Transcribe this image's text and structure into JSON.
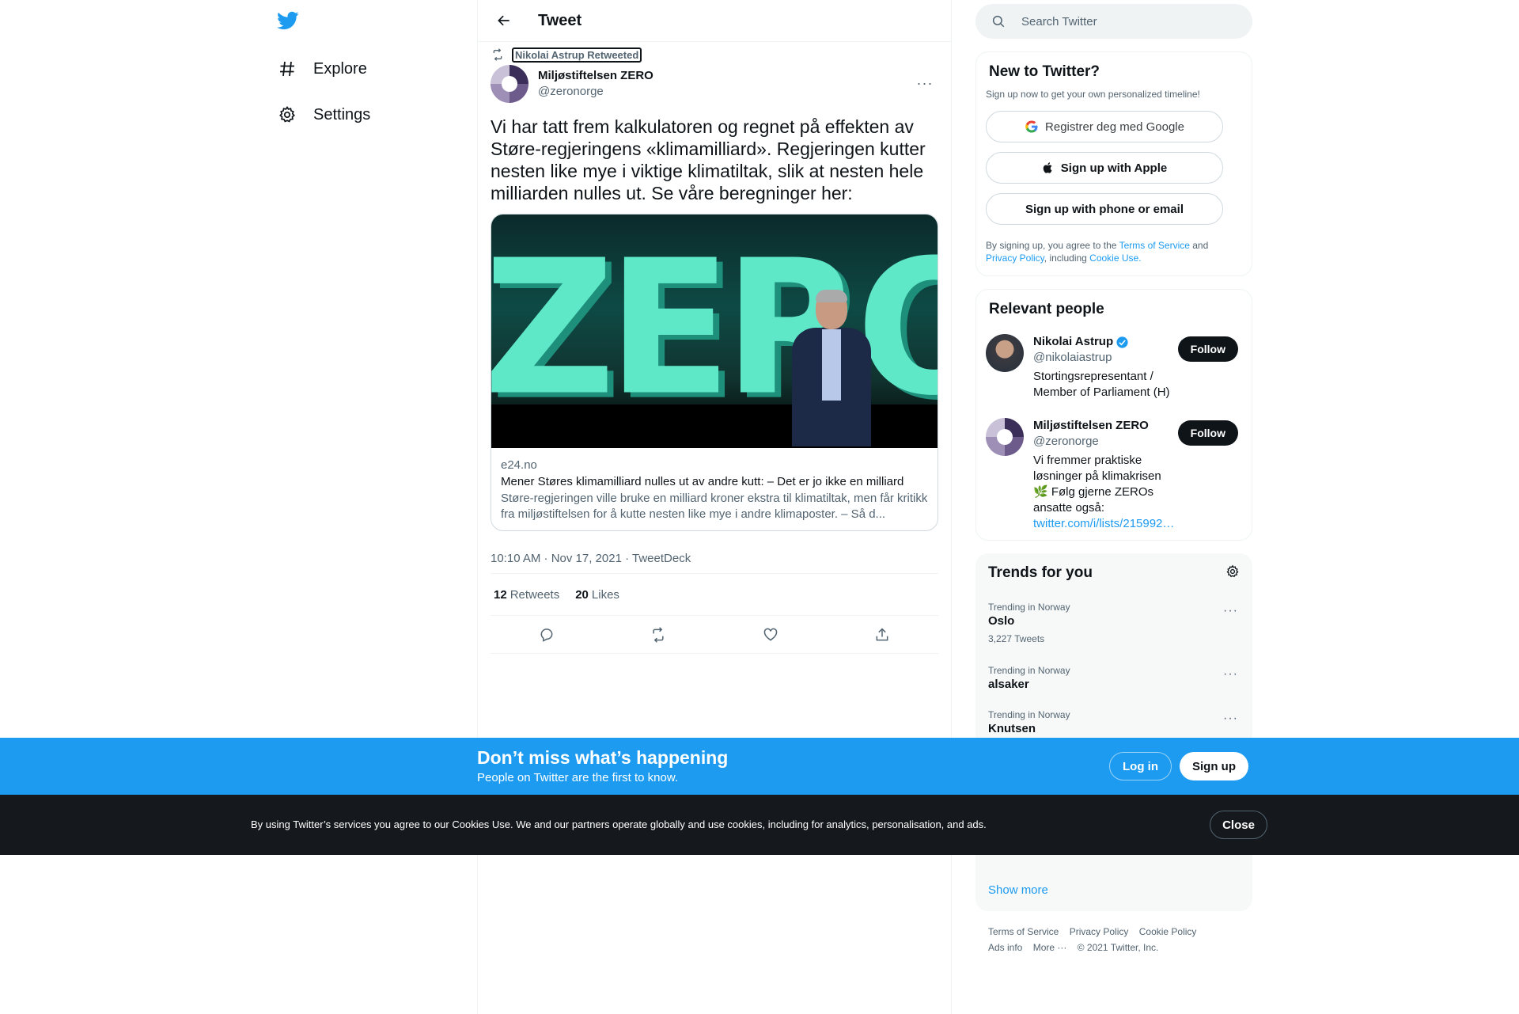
{
  "nav": {
    "logo": "twitter-bird-icon",
    "items": [
      {
        "label": "Explore",
        "icon": "hashtag-icon"
      },
      {
        "label": "Settings",
        "icon": "gear-icon"
      }
    ]
  },
  "header": {
    "title": "Tweet"
  },
  "tweet": {
    "retweeted_by": "Nikolai Astrup Retweeted",
    "author_name": "Miljøstiftelsen ZERO",
    "author_handle": "@zeronorge",
    "text": "Vi har tatt frem kalkulatoren og regnet på effekten av Støre-regjeringens «klimamilliard». Regjeringen kutter nesten like mye i viktige klimatiltak, slik at nesten hele milliarden nulles ut. Se våre beregninger her:",
    "card": {
      "image_text": "ZERO",
      "domain": "e24.no",
      "title": "Mener Støres klimamilliard nulles ut av andre kutt: – Det er jo ikke en milliard",
      "description": "Støre-regjeringen ville bruke en milliard kroner ekstra til klimatiltak, men får kritikk fra miljøstiftelsen for å kutte nesten like mye i andre klimaposter. – Så d..."
    },
    "timestamp": "10:10 AM · Nov 17, 2021 · TweetDeck",
    "retweets": "12",
    "retweets_label": "Retweets",
    "likes": "20",
    "likes_label": "Likes"
  },
  "search": {
    "placeholder": "Search Twitter"
  },
  "new_to_twitter": {
    "title": "New to Twitter?",
    "subtitle": "Sign up now to get your own personalized timeline!",
    "google": "Registrer deg med Google",
    "apple": "Sign up with Apple",
    "phone": "Sign up with phone or email",
    "terms_pre": "By signing up, you agree to the ",
    "terms_link": "Terms of Service",
    "terms_and": " and ",
    "privacy_link": "Privacy Policy",
    "terms_including": ", including ",
    "cookie_link": "Cookie Use."
  },
  "relevant": {
    "title": "Relevant people",
    "people": [
      {
        "name": "Nikolai Astrup",
        "handle": "@nikolaiastrup",
        "bio": "Stortingsrepresentant / Member of Parliament (H)",
        "follow": "Follow"
      },
      {
        "name": "Miljøstiftelsen ZERO",
        "handle": "@zeronorge",
        "bio": "Vi fremmer praktiske løsninger på klimakrisen🌿 Følg gjerne ZEROs ansatte også:",
        "link": "twitter.com/i/lists/215992…",
        "follow": "Follow"
      }
    ]
  },
  "trends": {
    "title": "Trends for you",
    "items": [
      {
        "context": "Trending in Norway",
        "name": "Oslo",
        "count": "3,227 Tweets"
      },
      {
        "context": "Trending in Norway",
        "name": "alsaker",
        "count": ""
      },
      {
        "context": "Trending in Norway",
        "name": "Knutsen",
        "count": ""
      }
    ],
    "show_more": "Show more"
  },
  "footer": {
    "links": [
      "Terms of Service",
      "Privacy Policy",
      "Cookie Policy",
      "Ads info",
      "More ···",
      "© 2021 Twitter, Inc."
    ]
  },
  "banner": {
    "title": "Don’t miss what’s happening",
    "subtitle": "People on Twitter are the first to know.",
    "login": "Log in",
    "signup": "Sign up"
  },
  "cookies": {
    "text": "By using Twitter’s services you agree to our Cookies Use. We and our partners operate globally and use cookies, including for analytics, personalisation, and ads.",
    "close": "Close"
  },
  "colors": {
    "accent": "#1d9bf0",
    "text": "#0f1419",
    "muted": "#536471",
    "cookie_bar": "#15181c"
  }
}
